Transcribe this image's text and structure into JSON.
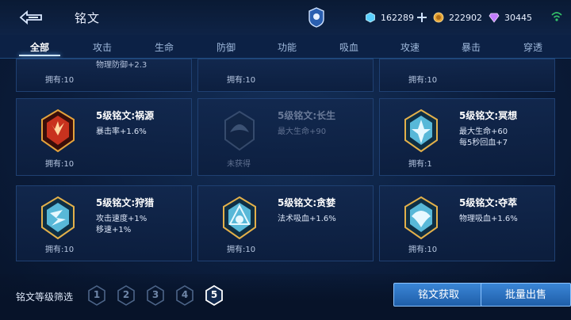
{
  "header": {
    "title": "铭文",
    "resources": [
      {
        "icon": "crystal-icon",
        "value": "162289"
      },
      {
        "icon": "coin-icon",
        "value": "222902"
      },
      {
        "icon": "diamond-icon",
        "value": "30445"
      }
    ]
  },
  "tabs": [
    {
      "label": "全部",
      "active": true
    },
    {
      "label": "攻击"
    },
    {
      "label": "生命"
    },
    {
      "label": "防御"
    },
    {
      "label": "功能"
    },
    {
      "label": "吸血"
    },
    {
      "label": "攻速"
    },
    {
      "label": "暴击"
    },
    {
      "label": "穿透"
    }
  ],
  "top_row": [
    {
      "partial_stat": "物理防御+2.3",
      "owned": "拥有:10"
    },
    {
      "partial_stat": "",
      "owned": "拥有:10"
    },
    {
      "partial_stat": "",
      "owned": "拥有:10"
    }
  ],
  "cards": [
    {
      "name": "5级铭文:祸源",
      "stat1": "暴击率+1.6%",
      "stat2": "",
      "owned": "拥有:10",
      "color": "#c8321e"
    },
    {
      "name": "5级铭文:长生",
      "stat1": "最大生命+90",
      "stat2": "",
      "owned": "未获得",
      "color": "#6b8aa8"
    },
    {
      "name": "5级铭文:冥想",
      "stat1": "最大生命+60",
      "stat2": "每5秒回血+7",
      "owned": "拥有:1",
      "color": "#58b8d8"
    },
    {
      "name": "5级铭文:狩猎",
      "stat1": "攻击速度+1%",
      "stat2": "移速+1%",
      "owned": "拥有:10",
      "color": "#58b8d8"
    },
    {
      "name": "5级铭文:贪婪",
      "stat1": "法术吸血+1.6%",
      "stat2": "",
      "owned": "拥有:10",
      "color": "#58b8d8"
    },
    {
      "name": "5级铭文:夺萃",
      "stat1": "物理吸血+1.6%",
      "stat2": "",
      "owned": "拥有:10",
      "color": "#58b8d8"
    }
  ],
  "filter": {
    "label": "铭文等级筛选",
    "levels": [
      "1",
      "2",
      "3",
      "4",
      "5"
    ],
    "selected": "5"
  },
  "buttons": {
    "get": "铭文获取",
    "sell": "批量出售"
  }
}
